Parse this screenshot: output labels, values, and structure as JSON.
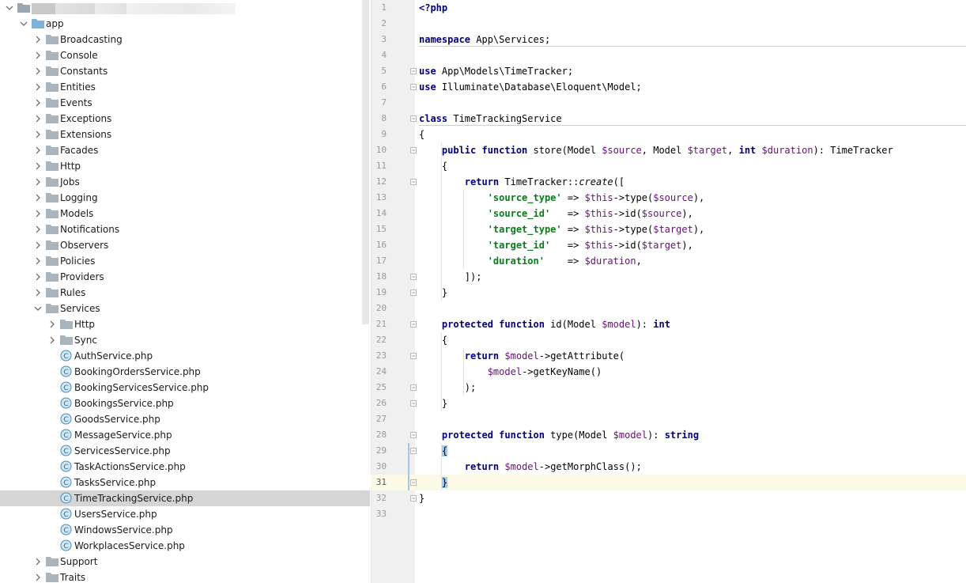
{
  "tree": {
    "root_chevron": "expanded",
    "items": [
      {
        "depth": 1,
        "type": "folder",
        "expanded": true,
        "label": "app"
      },
      {
        "depth": 2,
        "type": "folder",
        "expanded": false,
        "label": "Broadcasting"
      },
      {
        "depth": 2,
        "type": "folder",
        "expanded": false,
        "label": "Console"
      },
      {
        "depth": 2,
        "type": "folder",
        "expanded": false,
        "label": "Constants"
      },
      {
        "depth": 2,
        "type": "folder",
        "expanded": false,
        "label": "Entities"
      },
      {
        "depth": 2,
        "type": "folder",
        "expanded": false,
        "label": "Events"
      },
      {
        "depth": 2,
        "type": "folder",
        "expanded": false,
        "label": "Exceptions"
      },
      {
        "depth": 2,
        "type": "folder",
        "expanded": false,
        "label": "Extensions"
      },
      {
        "depth": 2,
        "type": "folder",
        "expanded": false,
        "label": "Facades"
      },
      {
        "depth": 2,
        "type": "folder",
        "expanded": false,
        "label": "Http"
      },
      {
        "depth": 2,
        "type": "folder",
        "expanded": false,
        "label": "Jobs"
      },
      {
        "depth": 2,
        "type": "folder",
        "expanded": false,
        "label": "Logging"
      },
      {
        "depth": 2,
        "type": "folder",
        "expanded": false,
        "label": "Models"
      },
      {
        "depth": 2,
        "type": "folder",
        "expanded": false,
        "label": "Notifications"
      },
      {
        "depth": 2,
        "type": "folder",
        "expanded": false,
        "label": "Observers"
      },
      {
        "depth": 2,
        "type": "folder",
        "expanded": false,
        "label": "Policies"
      },
      {
        "depth": 2,
        "type": "folder",
        "expanded": false,
        "label": "Providers"
      },
      {
        "depth": 2,
        "type": "folder",
        "expanded": false,
        "label": "Rules"
      },
      {
        "depth": 2,
        "type": "folder",
        "expanded": true,
        "label": "Services"
      },
      {
        "depth": 3,
        "type": "folder",
        "expanded": false,
        "label": "Http"
      },
      {
        "depth": 3,
        "type": "folder",
        "expanded": false,
        "label": "Sync"
      },
      {
        "depth": 3,
        "type": "file",
        "label": "AuthService.php"
      },
      {
        "depth": 3,
        "type": "file",
        "label": "BookingOrdersService.php"
      },
      {
        "depth": 3,
        "type": "file",
        "label": "BookingServicesService.php"
      },
      {
        "depth": 3,
        "type": "file",
        "label": "BookingsService.php"
      },
      {
        "depth": 3,
        "type": "file",
        "label": "GoodsService.php"
      },
      {
        "depth": 3,
        "type": "file",
        "label": "MessageService.php"
      },
      {
        "depth": 3,
        "type": "file",
        "label": "ServicesService.php"
      },
      {
        "depth": 3,
        "type": "file",
        "label": "TaskActionsService.php"
      },
      {
        "depth": 3,
        "type": "file",
        "label": "TasksService.php"
      },
      {
        "depth": 3,
        "type": "file",
        "label": "TimeTrackingService.php",
        "selected": true
      },
      {
        "depth": 3,
        "type": "file",
        "label": "UsersService.php"
      },
      {
        "depth": 3,
        "type": "file",
        "label": "WindowsService.php"
      },
      {
        "depth": 3,
        "type": "file",
        "label": "WorkplacesService.php"
      },
      {
        "depth": 2,
        "type": "folder",
        "expanded": false,
        "label": "Support"
      },
      {
        "depth": 2,
        "type": "folder",
        "expanded": false,
        "label": "Traits"
      }
    ]
  },
  "editor": {
    "current_line": 31,
    "lines": [
      [
        {
          "t": "<?php",
          "c": "kw"
        }
      ],
      [],
      [
        {
          "t": "namespace",
          "c": "kw"
        },
        {
          "t": " App\\Services;"
        }
      ],
      [],
      [
        {
          "t": "use",
          "c": "kw"
        },
        {
          "t": " App\\Models\\TimeTracker;"
        }
      ],
      [
        {
          "t": "use",
          "c": "kw"
        },
        {
          "t": " Illuminate\\Database\\Eloquent\\Model;"
        }
      ],
      [],
      [
        {
          "t": "class",
          "c": "kw"
        },
        {
          "t": " TimeTrackingService"
        }
      ],
      [
        {
          "t": "{"
        }
      ],
      [
        {
          "t": "    "
        },
        {
          "t": "public function",
          "c": "kw"
        },
        {
          "t": " store(Model "
        },
        {
          "t": "$source",
          "c": "var"
        },
        {
          "t": ", Model "
        },
        {
          "t": "$target",
          "c": "var"
        },
        {
          "t": ", "
        },
        {
          "t": "int",
          "c": "kw"
        },
        {
          "t": " "
        },
        {
          "t": "$duration",
          "c": "var"
        },
        {
          "t": "): TimeTracker"
        }
      ],
      [
        {
          "t": "    {"
        }
      ],
      [
        {
          "t": "        "
        },
        {
          "t": "return",
          "c": "kw"
        },
        {
          "t": " TimeTracker::"
        },
        {
          "t": "create",
          "c": "it"
        },
        {
          "t": "(["
        }
      ],
      [
        {
          "t": "            "
        },
        {
          "t": "'source_type'",
          "c": "str"
        },
        {
          "t": " => "
        },
        {
          "t": "$this",
          "c": "var"
        },
        {
          "t": "->type("
        },
        {
          "t": "$source",
          "c": "var"
        },
        {
          "t": "),"
        }
      ],
      [
        {
          "t": "            "
        },
        {
          "t": "'source_id'",
          "c": "str"
        },
        {
          "t": "   => "
        },
        {
          "t": "$this",
          "c": "var"
        },
        {
          "t": "->id("
        },
        {
          "t": "$source",
          "c": "var"
        },
        {
          "t": "),"
        }
      ],
      [
        {
          "t": "            "
        },
        {
          "t": "'target_type'",
          "c": "str"
        },
        {
          "t": " => "
        },
        {
          "t": "$this",
          "c": "var"
        },
        {
          "t": "->type("
        },
        {
          "t": "$target",
          "c": "var"
        },
        {
          "t": "),"
        }
      ],
      [
        {
          "t": "            "
        },
        {
          "t": "'target_id'",
          "c": "str"
        },
        {
          "t": "   => "
        },
        {
          "t": "$this",
          "c": "var"
        },
        {
          "t": "->id("
        },
        {
          "t": "$target",
          "c": "var"
        },
        {
          "t": "),"
        }
      ],
      [
        {
          "t": "            "
        },
        {
          "t": "'duration'",
          "c": "str"
        },
        {
          "t": "    => "
        },
        {
          "t": "$duration",
          "c": "var"
        },
        {
          "t": ","
        }
      ],
      [
        {
          "t": "        ]);"
        }
      ],
      [
        {
          "t": "    }"
        }
      ],
      [],
      [
        {
          "t": "    "
        },
        {
          "t": "protected function",
          "c": "kw"
        },
        {
          "t": " id(Model "
        },
        {
          "t": "$model",
          "c": "var"
        },
        {
          "t": "): "
        },
        {
          "t": "int",
          "c": "kw"
        }
      ],
      [
        {
          "t": "    {"
        }
      ],
      [
        {
          "t": "        "
        },
        {
          "t": "return",
          "c": "kw"
        },
        {
          "t": " "
        },
        {
          "t": "$model",
          "c": "var"
        },
        {
          "t": "->getAttribute("
        }
      ],
      [
        {
          "t": "            "
        },
        {
          "t": "$model",
          "c": "var"
        },
        {
          "t": "->getKeyName()"
        }
      ],
      [
        {
          "t": "        );"
        }
      ],
      [
        {
          "t": "    }"
        }
      ],
      [],
      [
        {
          "t": "    "
        },
        {
          "t": "protected function",
          "c": "kw"
        },
        {
          "t": " type(Model "
        },
        {
          "t": "$model",
          "c": "var"
        },
        {
          "t": "): "
        },
        {
          "t": "string",
          "c": "kw"
        }
      ],
      [
        {
          "t": "    "
        },
        {
          "t": "{",
          "c": "brace-hl"
        }
      ],
      [
        {
          "t": "        "
        },
        {
          "t": "return",
          "c": "kw"
        },
        {
          "t": " "
        },
        {
          "t": "$model",
          "c": "var"
        },
        {
          "t": "->getMorphClass();"
        }
      ],
      [
        {
          "t": "    "
        },
        {
          "t": "}",
          "c": "brace-hl"
        }
      ],
      [
        {
          "t": "}"
        }
      ],
      []
    ],
    "fold_markers": [
      5,
      6,
      8,
      10,
      12,
      18,
      19,
      21,
      23,
      25,
      26,
      28,
      29,
      31,
      32
    ],
    "separators_after": [
      2,
      7
    ]
  }
}
